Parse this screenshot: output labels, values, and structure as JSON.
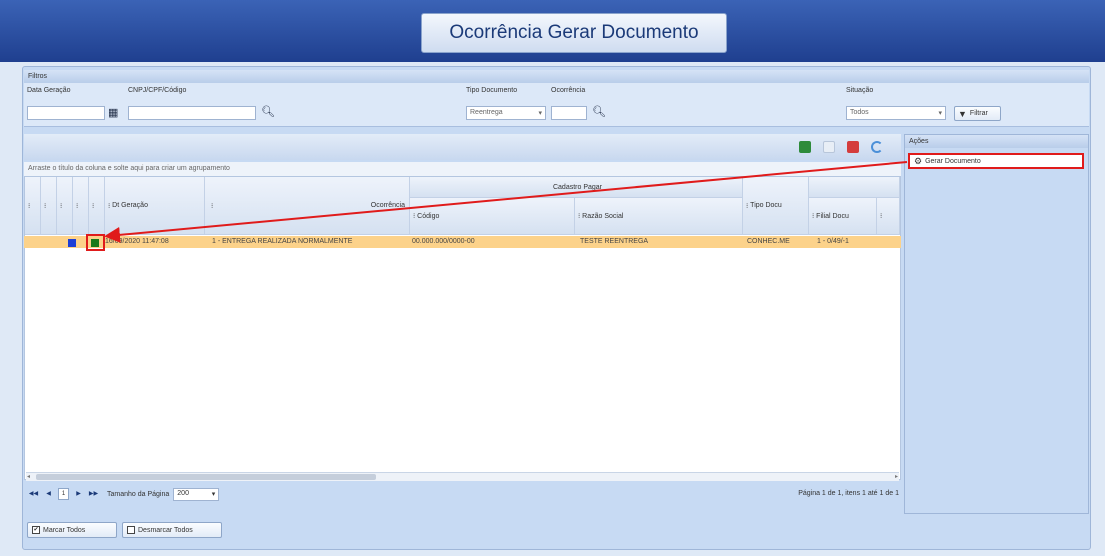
{
  "window": {
    "title": "Ocorrência Gerar Documento"
  },
  "filters": {
    "section_label": "Filtros",
    "data_geracao_label": "Data Geração",
    "cnpj_label": "CNPJ/CPF/Código",
    "tipo_documento_label": "Tipo Documento",
    "tipo_documento_value": "Reentrega",
    "ocorrencia_label": "Ocorrência",
    "situacao_label": "Situação",
    "situacao_value": "Todos",
    "filtrar_button": "Filtrar"
  },
  "grid": {
    "group_by_hint": "Arraste o título da coluna e solte aqui para criar um agrupamento",
    "columns": {
      "dt_geracao": "Dt Geração",
      "ocorrencia": "Ocorrência",
      "cadastro_pagar": "Cadastro Pagar",
      "codigo": "Código",
      "razao_social": "Razão Social",
      "tipo_doc": "Tipo Docu",
      "filial_doc": "Filial Docu"
    },
    "rows": [
      {
        "dt_geracao": "16/09/2020 11:47:08",
        "ocorrencia": "1 - ENTREGA REALIZADA NORMALMENTE",
        "codigo": "00.000.000/0000-00",
        "razao_social": "TESTE REENTREGA",
        "tipo_doc": "CONHEC.ME",
        "filial_doc": "1 - 0/49/-1"
      }
    ]
  },
  "pager": {
    "current_page": "1",
    "page_size_label": "Tamanho da Página",
    "page_size_value": "200",
    "info": "Página 1 de 1, itens 1 até 1 de 1"
  },
  "bottom": {
    "marcar_todos": "Marcar Todos",
    "desmarcar_todos": "Desmarcar Todos"
  },
  "acoes": {
    "header": "Ações",
    "gerar_documento": "Gerar Documento"
  },
  "colors": {
    "highlight": "#e01b1b",
    "selected_row": "#fcd28a",
    "blue_square": "#1d3fd6",
    "green_square": "#1a7a1a"
  }
}
